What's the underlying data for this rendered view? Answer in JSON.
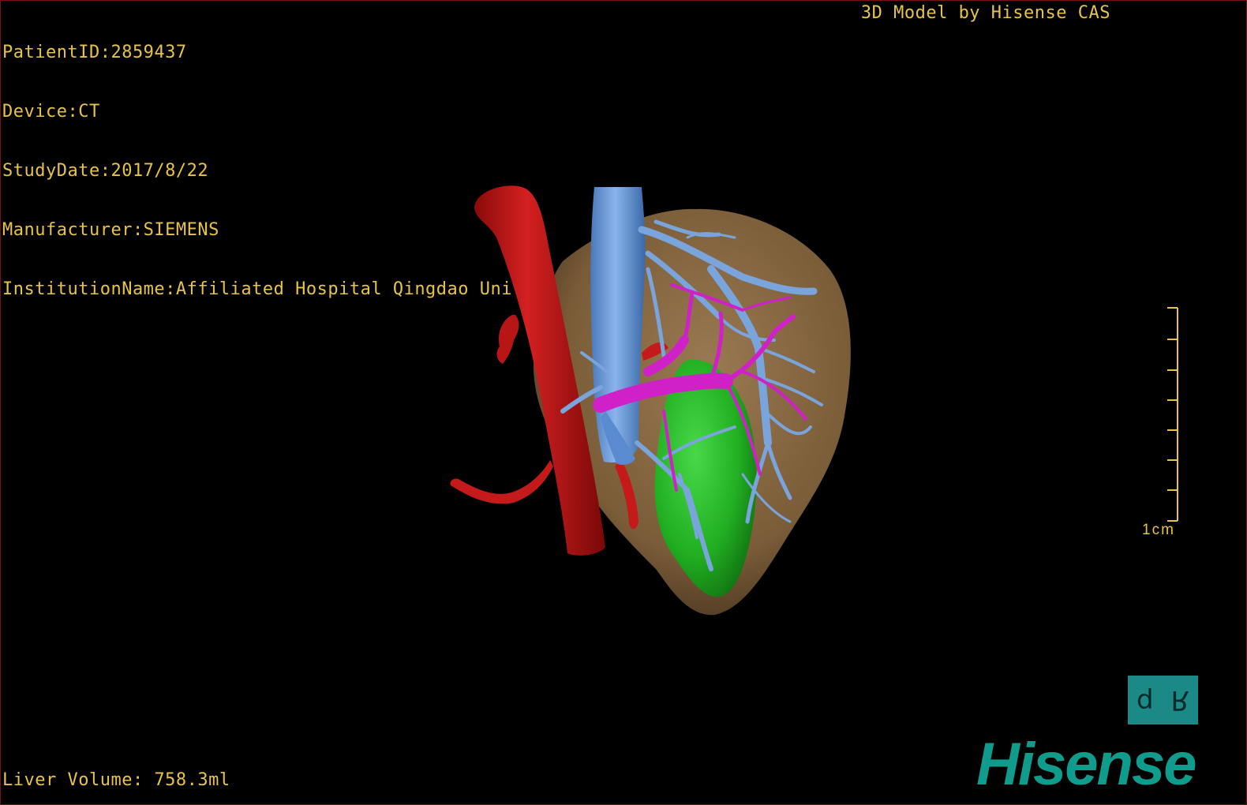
{
  "header": {
    "patient_id": "PatientID:2859437",
    "device": "Device:CT",
    "study_date": "StudyDate:2017/8/22",
    "manufacturer": "Manufacturer:SIEMENS",
    "institution": "InstitutionName:Affiliated Hospital Qingdao University-C",
    "model_credit": "3D Model by Hisense CAS"
  },
  "footer": {
    "liver_volume": "Liver Volume: 758.3ml"
  },
  "scale": {
    "label": "1cm"
  },
  "view_cube": {
    "face_left": "d",
    "face_right": "R"
  },
  "brand": {
    "logo_text": "Hisense"
  },
  "colors": {
    "overlay_text": "#e8c34a",
    "liver": "#8a6a44",
    "artery": "#c41a1a",
    "vein": "#6a9ad8",
    "portal_vein": "#d020c8",
    "tumor": "#22b022",
    "brand": "#0f9c8c",
    "view_cube": "#1b8a86"
  }
}
